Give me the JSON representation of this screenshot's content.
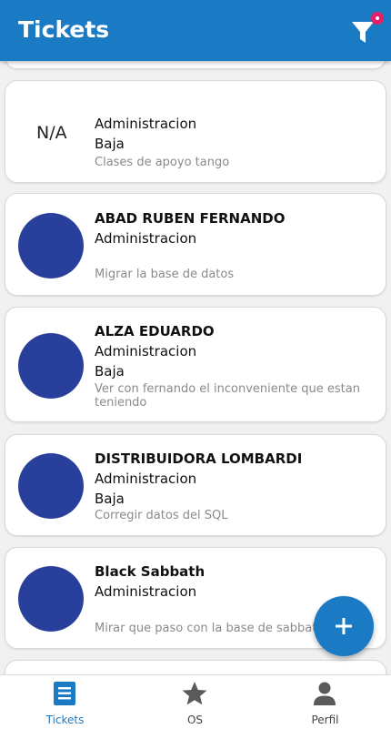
{
  "header": {
    "title": "Tickets"
  },
  "tickets": [
    {
      "avatar": "N/A",
      "line1": "",
      "line2": "Administracion",
      "line3": "Baja",
      "description": "Clases de apoyo tango"
    },
    {
      "avatar": "",
      "line1": "ABAD RUBEN FERNANDO",
      "line2": "Administracion",
      "line3": "",
      "description": "Migrar la base de datos"
    },
    {
      "avatar": "",
      "line1": "ALZA EDUARDO",
      "line2": "Administracion",
      "line3": "Baja",
      "description": "Ver con fernando el inconveniente que estan teniendo"
    },
    {
      "avatar": "",
      "line1": "DISTRIBUIDORA LOMBARDI",
      "line2": "Administracion",
      "line3": "Baja",
      "description": "Corregir datos del SQL"
    },
    {
      "avatar": "",
      "line1": "Black Sabbath",
      "line2": "Administracion",
      "line3": "",
      "description": "Mirar que paso con la base de sabbath"
    }
  ],
  "bottom_nav": {
    "items": [
      {
        "label": "Tickets",
        "icon": "list-icon",
        "active": true
      },
      {
        "label": "OS",
        "icon": "star-icon",
        "active": false
      },
      {
        "label": "Perfil",
        "icon": "person-icon",
        "active": false
      }
    ]
  },
  "colors": {
    "primary": "#1a7bc4",
    "avatar": "#283f9b",
    "badge": "#e91e63"
  }
}
